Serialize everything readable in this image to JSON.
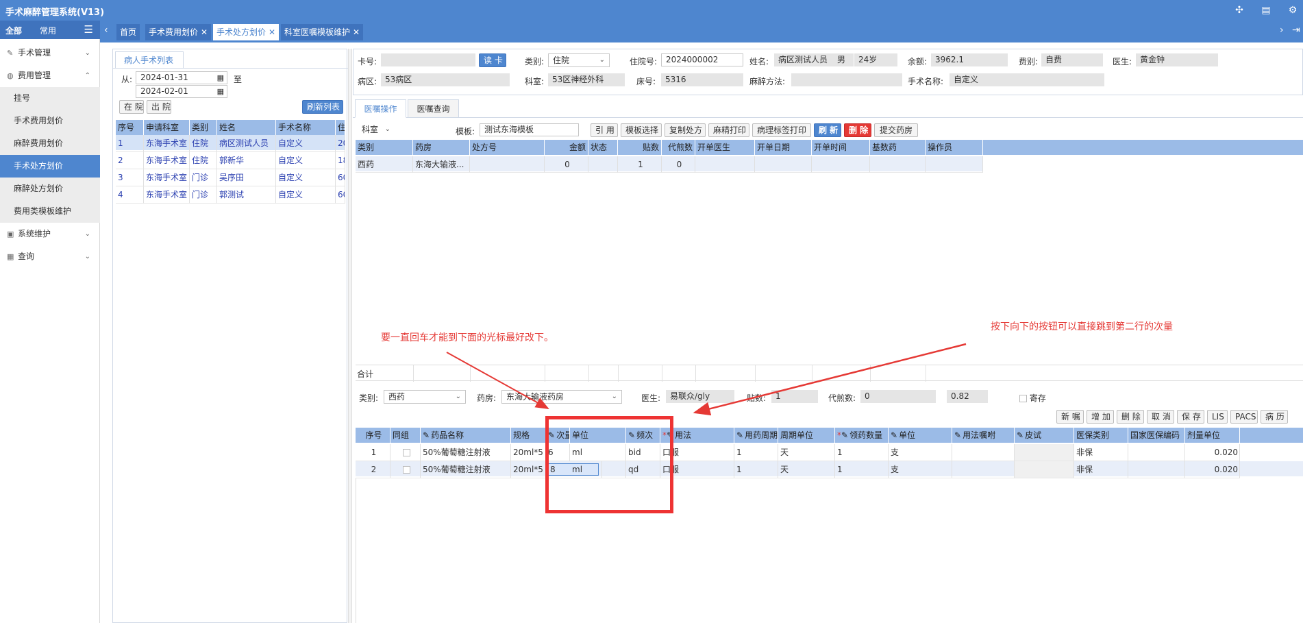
{
  "app": {
    "title": "手术麻醉管理系统(V13)"
  },
  "topbar_icons": [
    "puzzle-icon",
    "clipboard-icon",
    "gear-icon"
  ],
  "sidebar": {
    "tabs": [
      "全部",
      "常用"
    ],
    "sections": [
      {
        "label": "手术管理"
      },
      {
        "label": "费用管理"
      },
      {
        "label": "系统维护"
      },
      {
        "label": "查询"
      }
    ],
    "sub_items": [
      "挂号",
      "手术费用划价",
      "麻醉费用划价",
      "手术处方划价",
      "麻醉处方划价",
      "费用类模板维护"
    ]
  },
  "tabs": [
    {
      "label": "首页"
    },
    {
      "label": "手术费用划价"
    },
    {
      "label": "手术处方划价"
    },
    {
      "label": "科室医嘱模板维护"
    }
  ],
  "patient_list": {
    "tab_label": "病人手术列表",
    "from_label": "从:",
    "to_label": "至",
    "date_from": "2024-01-31",
    "date_to": "2024-02-01",
    "btn_in": "在 院",
    "btn_out": "出 院",
    "btn_refresh": "刷新列表",
    "columns": [
      "序号",
      "申请科室",
      "类别",
      "姓名",
      "手术名称",
      "住"
    ],
    "rows": [
      [
        "1",
        "东海手术室",
        "住院",
        "病区测试人员",
        "自定义",
        "20"
      ],
      [
        "2",
        "东海手术室",
        "住院",
        "郭新华",
        "自定义",
        "18"
      ],
      [
        "3",
        "东海手术室",
        "门诊",
        "吴序田",
        "自定义",
        "60"
      ],
      [
        "4",
        "东海手术室",
        "门诊",
        "郭测试",
        "自定义",
        "60"
      ]
    ]
  },
  "patient_info": {
    "card_label": "卡号:",
    "card_value": "",
    "read_card": "读 卡",
    "type_label": "类别:",
    "type_value": "住院",
    "inpatient_label": "住院号:",
    "inpatient_value": "2024000002",
    "name_label": "姓名:",
    "name_value": "病区测试人员",
    "gender": "男",
    "age": "24岁",
    "balance_label": "余额:",
    "balance_value": "3962.1",
    "fee_label": "费别:",
    "fee_value": "自费",
    "doctor_label": "医生:",
    "doctor_value": "黄金钟",
    "ward_label": "病区:",
    "ward_value": "53病区",
    "dept_label": "科室:",
    "dept_value": "53区神经外科",
    "bed_label": "床号:",
    "bed_value": "5316",
    "anes_label": "麻醉方法:",
    "anes_value": "",
    "surgery_label": "手术名称:",
    "surgery_value": "自定义"
  },
  "order_tabs": [
    "医嘱操作",
    "医嘱查询"
  ],
  "order_toolbar": {
    "dept_select": "科室",
    "template_label": "模板:",
    "template_value": "测试东海模板",
    "buttons": [
      "引 用",
      "模板选择",
      "复制处方",
      "麻精打印",
      "病理标签打印"
    ],
    "refresh": "刷 新",
    "delete": "删 除",
    "submit": "提交药房"
  },
  "rx_table": {
    "columns": [
      "类别",
      "药房",
      "处方号",
      "金额",
      "状态",
      "贴数",
      "代煎数",
      "开单医生",
      "开单日期",
      "开单时间",
      "基数药",
      "操作员"
    ],
    "rows": [
      [
        "西药",
        "东海大输液...",
        "",
        "0",
        "",
        "1",
        "0",
        "",
        "",
        "",
        "",
        ""
      ]
    ],
    "total_label": "合计"
  },
  "annotations": {
    "left": "要一直回车才能到下面的光标最好改下。",
    "right": "按下向下的按钮可以直接跳到第二行的次量"
  },
  "detail_form": {
    "type_label": "类别:",
    "type_value": "西药",
    "pharmacy_label": "药房:",
    "pharmacy_value": "东海大输液药房",
    "doctor_label": "医生:",
    "doctor_value": "易联众/gly",
    "tie_label": "贴数:",
    "tie_value": "1",
    "decoct_label": "代煎数:",
    "decoct_value": "0",
    "extra_value": "0.82",
    "deposit_label": "寄存"
  },
  "detail_buttons": [
    "新 嘱",
    "增 加",
    "删 除",
    "取 消",
    "保 存",
    "LIS",
    "PACS",
    "病 历"
  ],
  "detail_table": {
    "columns": [
      "序号",
      "同组",
      "药品名称",
      "规格",
      "次量",
      "单位",
      "频次",
      "用法",
      "用药周期",
      "周期单位",
      "领药数量",
      "单位",
      "用法嘱咐",
      "皮试",
      "医保类别",
      "国家医保编码",
      "剂量单位"
    ],
    "rows": [
      [
        "1",
        "",
        "50%葡萄糖注射液",
        "20ml*5",
        "6",
        "ml",
        "bid",
        "口服",
        "1",
        "天",
        "1",
        "支",
        "",
        "",
        "非保",
        "",
        "0.020"
      ],
      [
        "2",
        "",
        "50%葡萄糖注射液",
        "20ml*5",
        "8",
        "ml",
        "qd",
        "口服",
        "1",
        "天",
        "1",
        "支",
        "",
        "",
        "非保",
        "",
        "0.020"
      ]
    ]
  },
  "colors": {
    "primary": "#4e86cf",
    "dark": "#3f73bd",
    "header": "#9bbbe7",
    "annotation": "#e53935"
  }
}
